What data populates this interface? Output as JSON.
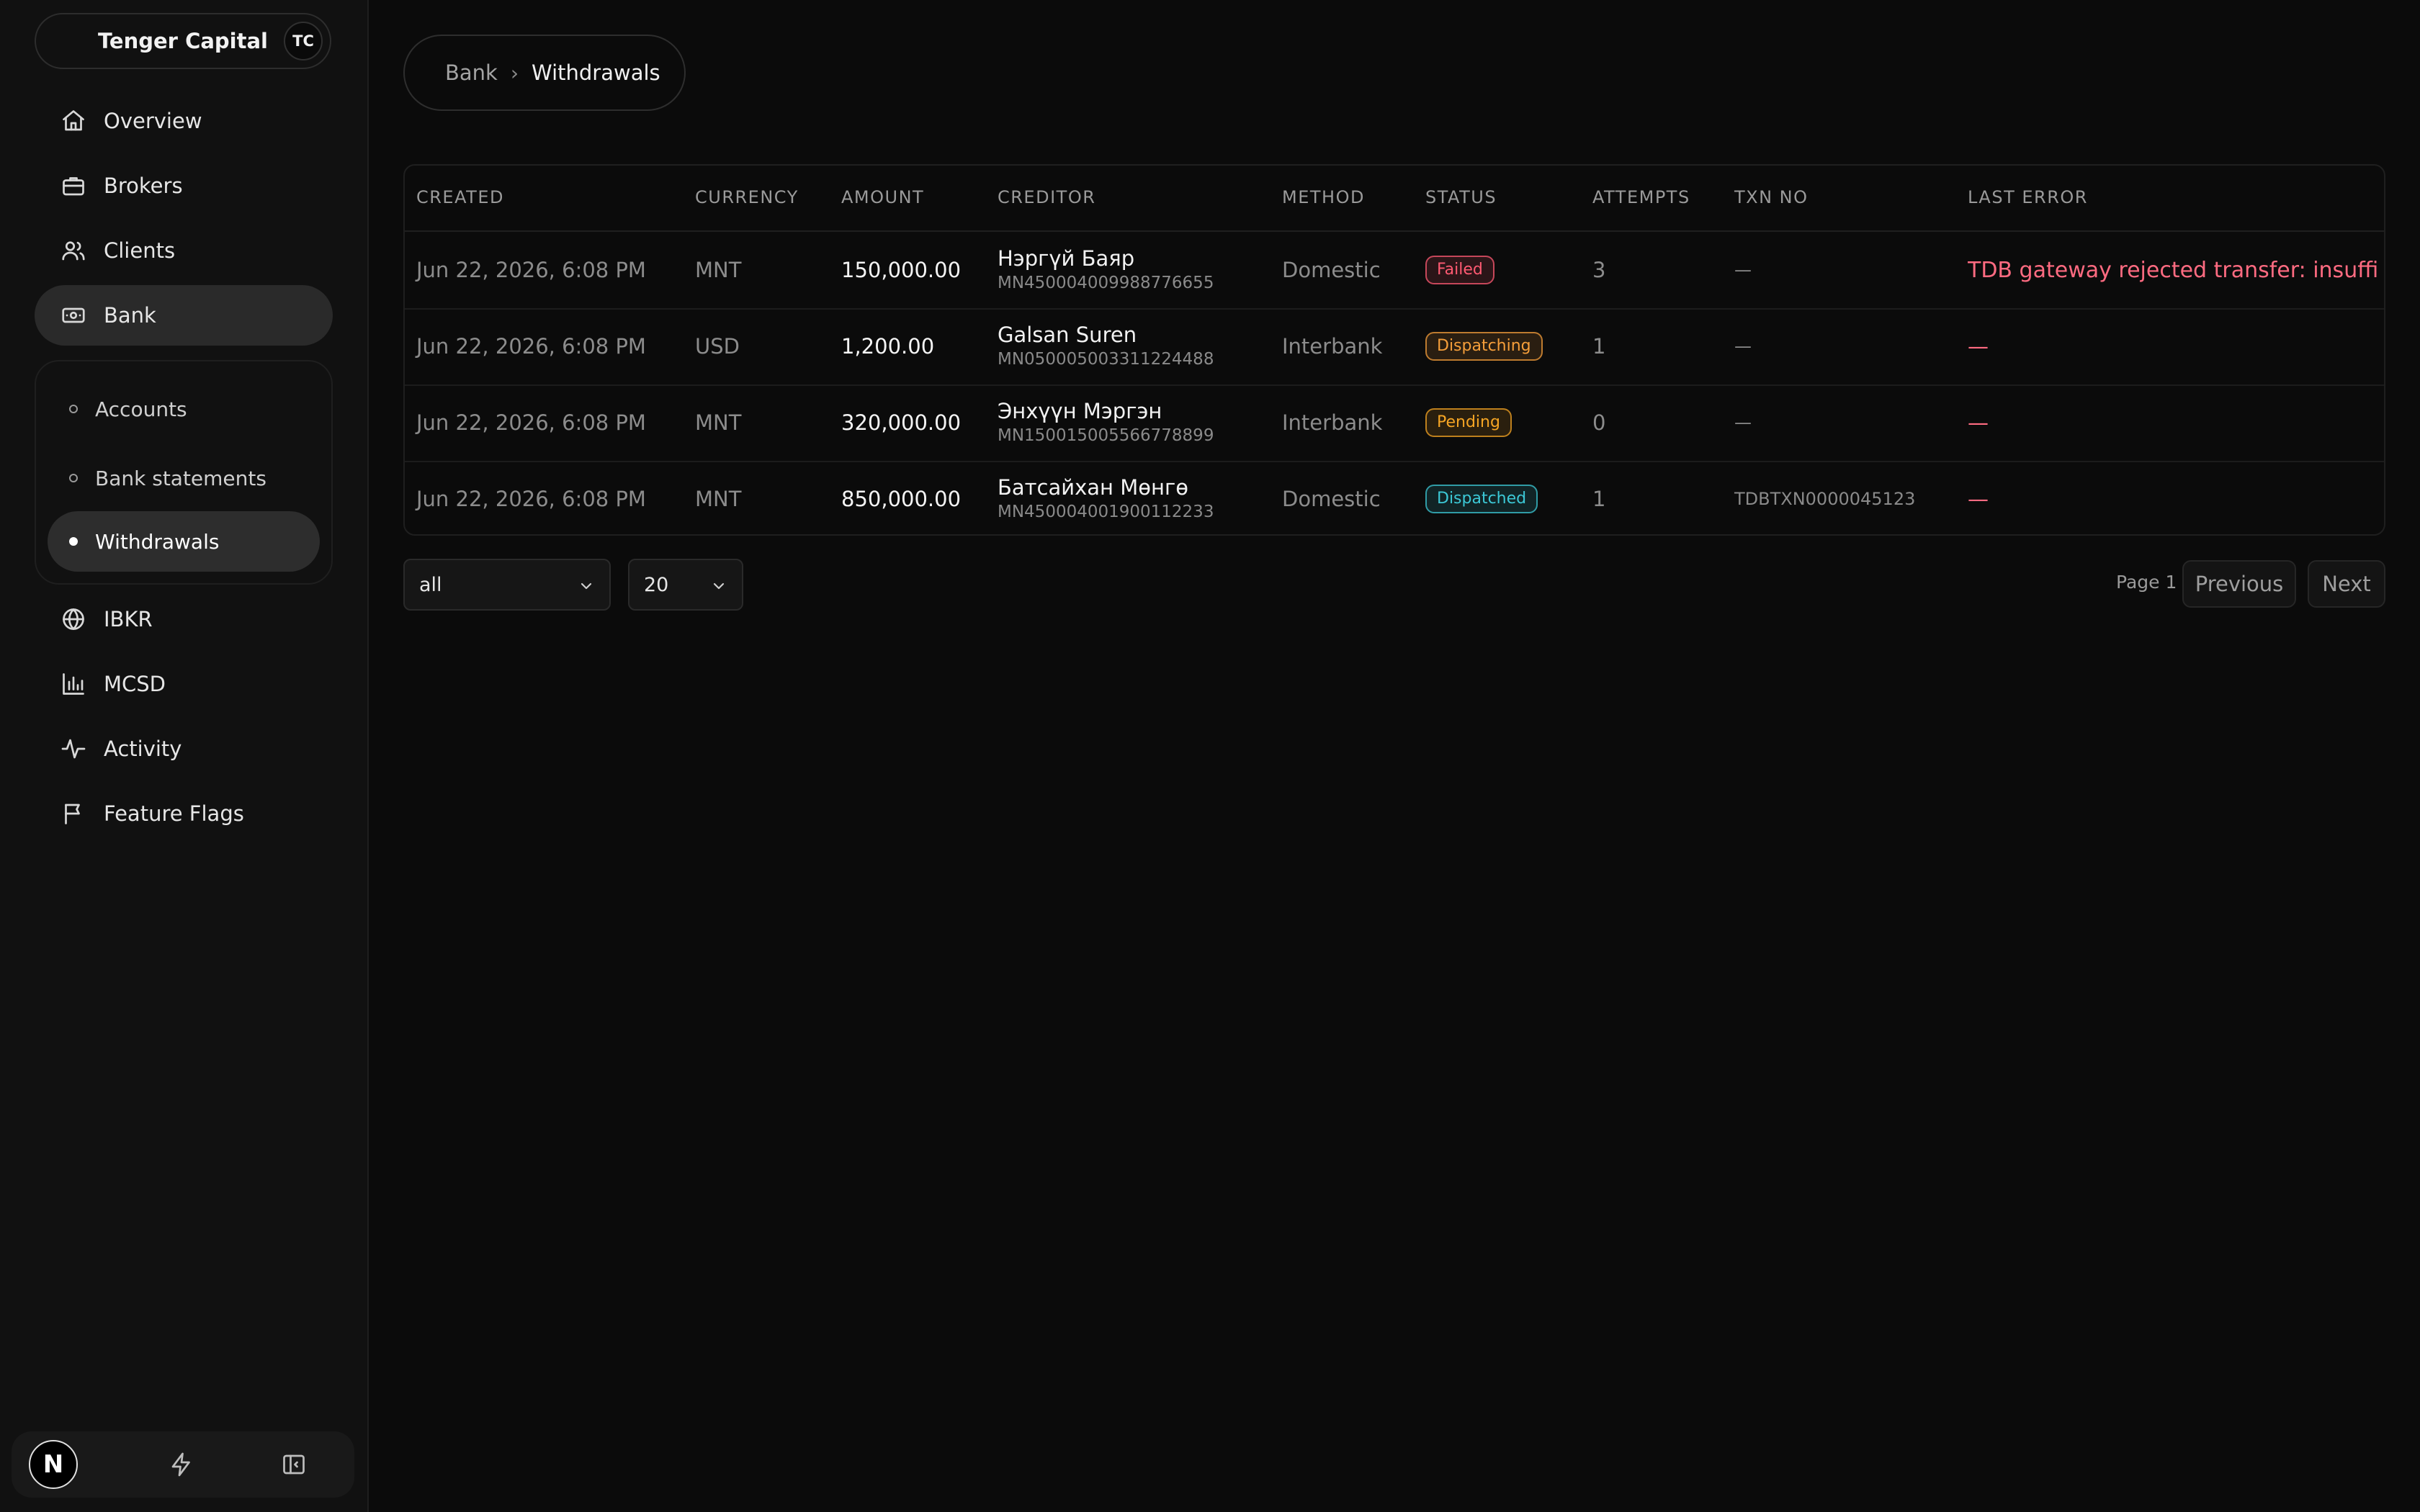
{
  "brand": {
    "name": "Tenger Capital",
    "avatar": "TC"
  },
  "nav": {
    "items": [
      {
        "label": "Overview",
        "icon": "home-icon"
      },
      {
        "label": "Brokers",
        "icon": "briefcase-icon"
      },
      {
        "label": "Clients",
        "icon": "users-icon"
      },
      {
        "label": "Bank",
        "icon": "banknote-icon",
        "active": true
      },
      {
        "label": "IBKR",
        "icon": "globe-icon"
      },
      {
        "label": "MCSD",
        "icon": "bar-chart-icon"
      },
      {
        "label": "Activity",
        "icon": "activity-icon"
      },
      {
        "label": "Feature Flags",
        "icon": "flag-icon"
      }
    ],
    "bank_sub": [
      {
        "label": "Accounts"
      },
      {
        "label": "Bank statements"
      },
      {
        "label": "Withdrawals",
        "active": true
      }
    ]
  },
  "footer": {
    "logo": "N",
    "icons": [
      "zap-icon",
      "panel-collapse-icon"
    ]
  },
  "breadcrumb": {
    "parent": "Bank",
    "separator": "›",
    "current": "Withdrawals"
  },
  "table": {
    "columns": [
      "CREATED",
      "CURRENCY",
      "AMOUNT",
      "CREDITOR",
      "METHOD",
      "STATUS",
      "ATTEMPTS",
      "TXN NO",
      "LAST ERROR"
    ],
    "rows": [
      {
        "created": "Jun 22, 2026, 6:08 PM",
        "currency": "MNT",
        "amount": "150,000.00",
        "creditor_name": "Нэргүй Баяр",
        "creditor_account": "MN450004009988776655",
        "method": "Domestic",
        "status": "Failed",
        "attempts": "3",
        "txn_no": "—",
        "last_error": "TDB gateway rejected transfer: insufficie..."
      },
      {
        "created": "Jun 22, 2026, 6:08 PM",
        "currency": "USD",
        "amount": "1,200.00",
        "creditor_name": "Galsan Suren",
        "creditor_account": "MN050005003311224488",
        "method": "Interbank",
        "status": "Dispatching",
        "attempts": "1",
        "txn_no": "—",
        "last_error": "—"
      },
      {
        "created": "Jun 22, 2026, 6:08 PM",
        "currency": "MNT",
        "amount": "320,000.00",
        "creditor_name": "Энхүүн Мэргэн",
        "creditor_account": "MN150015005566778899",
        "method": "Interbank",
        "status": "Pending",
        "attempts": "0",
        "txn_no": "—",
        "last_error": "—"
      },
      {
        "created": "Jun 22, 2026, 6:08 PM",
        "currency": "MNT",
        "amount": "850,000.00",
        "creditor_name": "Батсайхан Мөнгө",
        "creditor_account": "MN450004001900112233",
        "method": "Domestic",
        "status": "Dispatched",
        "attempts": "1",
        "txn_no": "TDBTXN0000045123",
        "last_error": "—"
      }
    ]
  },
  "status_colors": {
    "Failed": "#ff5a72",
    "Dispatching": "#f59e3a",
    "Pending": "#f5a524",
    "Dispatched": "#3cc8d6"
  },
  "filters": {
    "status_value": "all",
    "page_size_value": "20"
  },
  "pagination": {
    "page_label": "Page 1",
    "previous": "Previous",
    "next": "Next"
  }
}
